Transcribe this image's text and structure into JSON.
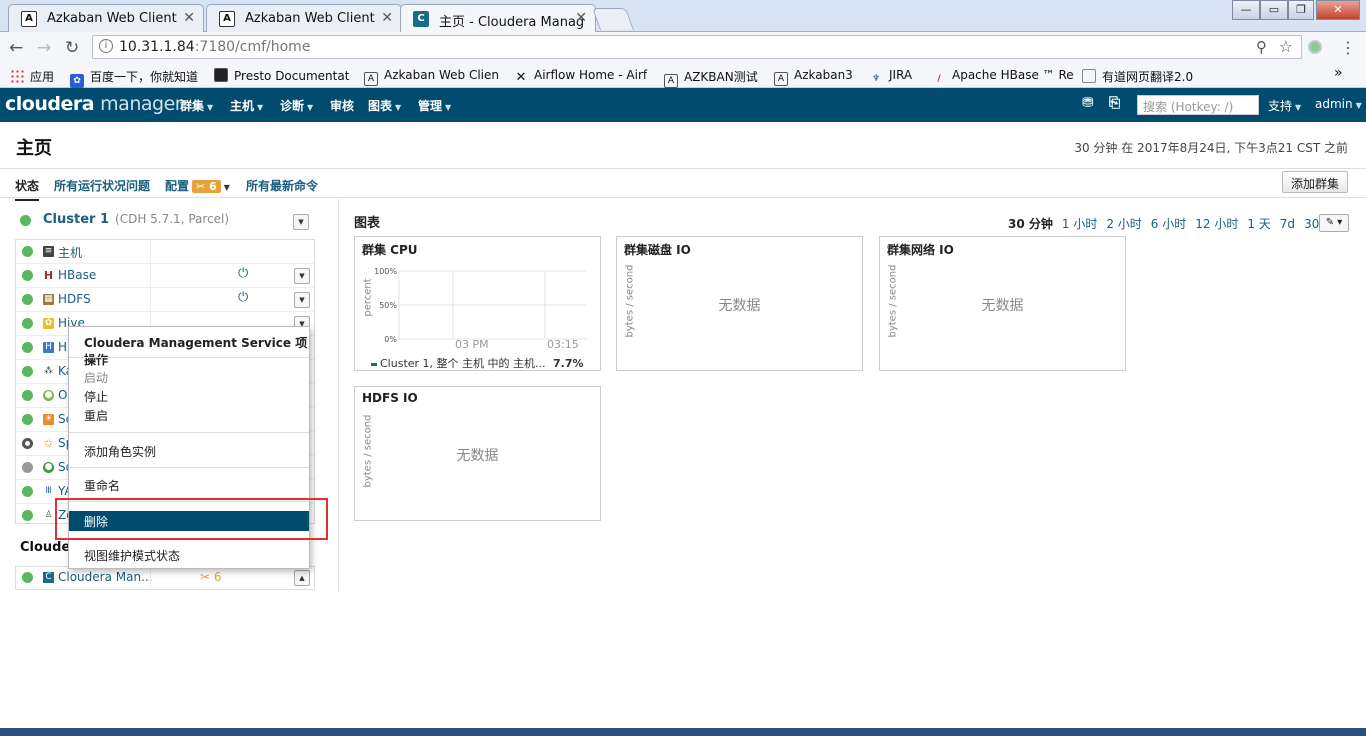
{
  "browser": {
    "tabs": [
      {
        "label": "Azkaban Web Client",
        "icon": "azkaban-icon"
      },
      {
        "label": "Azkaban Web Client",
        "icon": "azkaban-icon"
      },
      {
        "label": "主页 - Cloudera Manag",
        "icon": "cloudera-icon"
      }
    ],
    "url_host": "10.31.1.84",
    "url_path": ":7180/cmf/home",
    "bookmarks": [
      "应用",
      "百度一下，你就知道",
      "Presto Documentat",
      "Azkaban Web Clien",
      "Airflow Home - Airf",
      "AZKBAN测试",
      "Azkaban3",
      "JIRA",
      "Apache HBase ™ Re",
      "有道网页翻译2.0"
    ],
    "bookmarks_more": "»"
  },
  "header": {
    "logo_main": "cloudera",
    "logo_sub": "manager",
    "menus": [
      "群集",
      "主机",
      "诊断",
      "审核",
      "图表",
      "管理"
    ],
    "search_placeholder": "搜索 (Hotkey: /)",
    "support": "支持",
    "user": "admin"
  },
  "page": {
    "title": "主页",
    "timestamp": "30 分钟 在 2017年8月24日, 下午3点21 CST 之前",
    "subnav": {
      "status": "状态",
      "health_issues": "所有运行状况问题",
      "config": "配置",
      "config_count": "6",
      "recent_commands": "所有最新命令"
    },
    "add_cluster": "添加群集"
  },
  "cluster": {
    "name": "Cluster 1",
    "version": "(CDH 5.7.1, Parcel)",
    "services": [
      {
        "name": "主机",
        "icon": "hosts-icon"
      },
      {
        "name": "HBase",
        "icon": "hbase-icon"
      },
      {
        "name": "HDFS",
        "icon": "hdfs-icon"
      },
      {
        "name": "Hive",
        "icon": "hive-icon"
      },
      {
        "name": "Hu",
        "icon": "hue-icon"
      },
      {
        "name": "Ka",
        "icon": "kafka-icon"
      },
      {
        "name": "Oo",
        "icon": "oozie-icon"
      },
      {
        "name": "Sc",
        "icon": "solr-icon"
      },
      {
        "name": "Sp",
        "icon": "spark-icon"
      },
      {
        "name": "Sq",
        "icon": "sqoop-icon"
      },
      {
        "name": "YA",
        "icon": "yarn-icon"
      },
      {
        "name": "Zo",
        "icon": "zookeeper-icon"
      }
    ]
  },
  "mgmt": {
    "title": "Clouder",
    "service_name": "Cloudera Man...",
    "config_count": "6"
  },
  "context_menu": {
    "header": "Cloudera Management Service 项操作",
    "start": "启动",
    "stop": "停止",
    "restart": "重启",
    "add_role": "添加角色实例",
    "rename": "重命名",
    "delete": "删除",
    "maintenance": "视图维护模式状态"
  },
  "charts": {
    "title": "图表",
    "time_ranges": [
      "30 分钟",
      "1 小时",
      "2 小时",
      "6 小时",
      "12 小时",
      "1 天",
      "7d",
      "30d"
    ],
    "cpu": {
      "title": "群集 CPU",
      "ylabel": "percent",
      "yticks": [
        "100%",
        "50%",
        "0%"
      ],
      "xticks": [
        "03 PM",
        "03:15"
      ],
      "legend": "Cluster 1, 整个 主机 中的 主机...",
      "legend_value": "7.7%"
    },
    "disk": {
      "title": "群集磁盘 IO",
      "ylabel": "bytes / second",
      "empty": "无数据"
    },
    "network": {
      "title": "群集网络 IO",
      "ylabel": "bytes / second",
      "empty": "无数据"
    },
    "hdfs": {
      "title": "HDFS IO",
      "ylabel": "bytes / second",
      "empty": "无数据"
    }
  }
}
